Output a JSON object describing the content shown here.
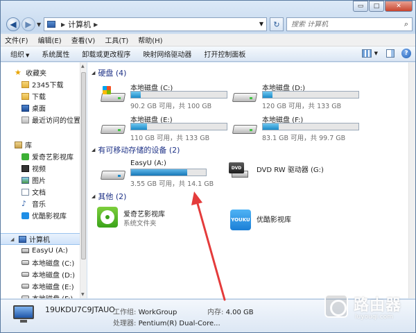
{
  "address": {
    "crumb": "计算机"
  },
  "search": {
    "placeholder": "搜索 计算机"
  },
  "window_controls": {
    "minimize": "▭",
    "maximize": "□",
    "close": "✕"
  },
  "menu": [
    "文件(F)",
    "编辑(E)",
    "查看(V)",
    "工具(T)",
    "帮助(H)"
  ],
  "toolbar": [
    "组织",
    "系统属性",
    "卸载或更改程序",
    "映射网络驱动器",
    "打开控制面板"
  ],
  "sidebar": {
    "favorites": {
      "label": "收藏夹",
      "items": [
        "2345下载",
        "下载",
        "桌面",
        "最近访问的位置"
      ]
    },
    "libraries": {
      "label": "库",
      "items": [
        "爱奇艺影视库",
        "视频",
        "图片",
        "文档",
        "音乐",
        "优酷影视库"
      ]
    },
    "computer": {
      "label": "计算机",
      "items": [
        "EasyU (A:)",
        "本地磁盘 (C:)",
        "本地磁盘 (D:)",
        "本地磁盘 (E:)",
        "本地磁盘 (F:)"
      ]
    }
  },
  "groups": {
    "hdd": "硬盘 (4)",
    "removable": "有可移动存储的设备 (2)",
    "other": "其他 (2)"
  },
  "drives": [
    {
      "name": "本地磁盘 (C:)",
      "info": "90.2 GB 可用，共 100 GB",
      "used_fraction": 0.1
    },
    {
      "name": "本地磁盘 (D:)",
      "info": "120 GB 可用，共 133 GB",
      "used_fraction": 0.1
    },
    {
      "name": "本地磁盘 (E:)",
      "info": "110 GB 可用，共 133 GB",
      "used_fraction": 0.17
    },
    {
      "name": "本地磁盘 (F:)",
      "info": "83.1 GB 可用，共 99.7 GB",
      "used_fraction": 0.17
    }
  ],
  "removable": [
    {
      "name": "EasyU (A:)",
      "info": "3.55 GB 可用，共 14.1 GB",
      "used_fraction": 0.75
    },
    {
      "name": "DVD RW 驱动器 (G:)"
    }
  ],
  "others": [
    {
      "name": "爱奇艺影视库",
      "sub": "系统文件夹"
    },
    {
      "name": "优酷影视库"
    }
  ],
  "youku_logo_text": "YOUKU",
  "dvd_logo_text": "DVD",
  "details": {
    "computer_name": "19UKDU7C9JTAUO",
    "workgroup_key": "工作组:",
    "workgroup_val": "WorkGroup",
    "memory_key": "内存:",
    "memory_val": "4.00 GB",
    "cpu_key": "处理器:",
    "cpu_val": "Pentium(R) Dual-Core..."
  },
  "watermark": {
    "title": "路由器",
    "url": "luyouqi.com"
  },
  "colors": {
    "accent": "#1e3287",
    "bar_fill": "#1c8ac8",
    "arrow": "#e43b3b"
  }
}
